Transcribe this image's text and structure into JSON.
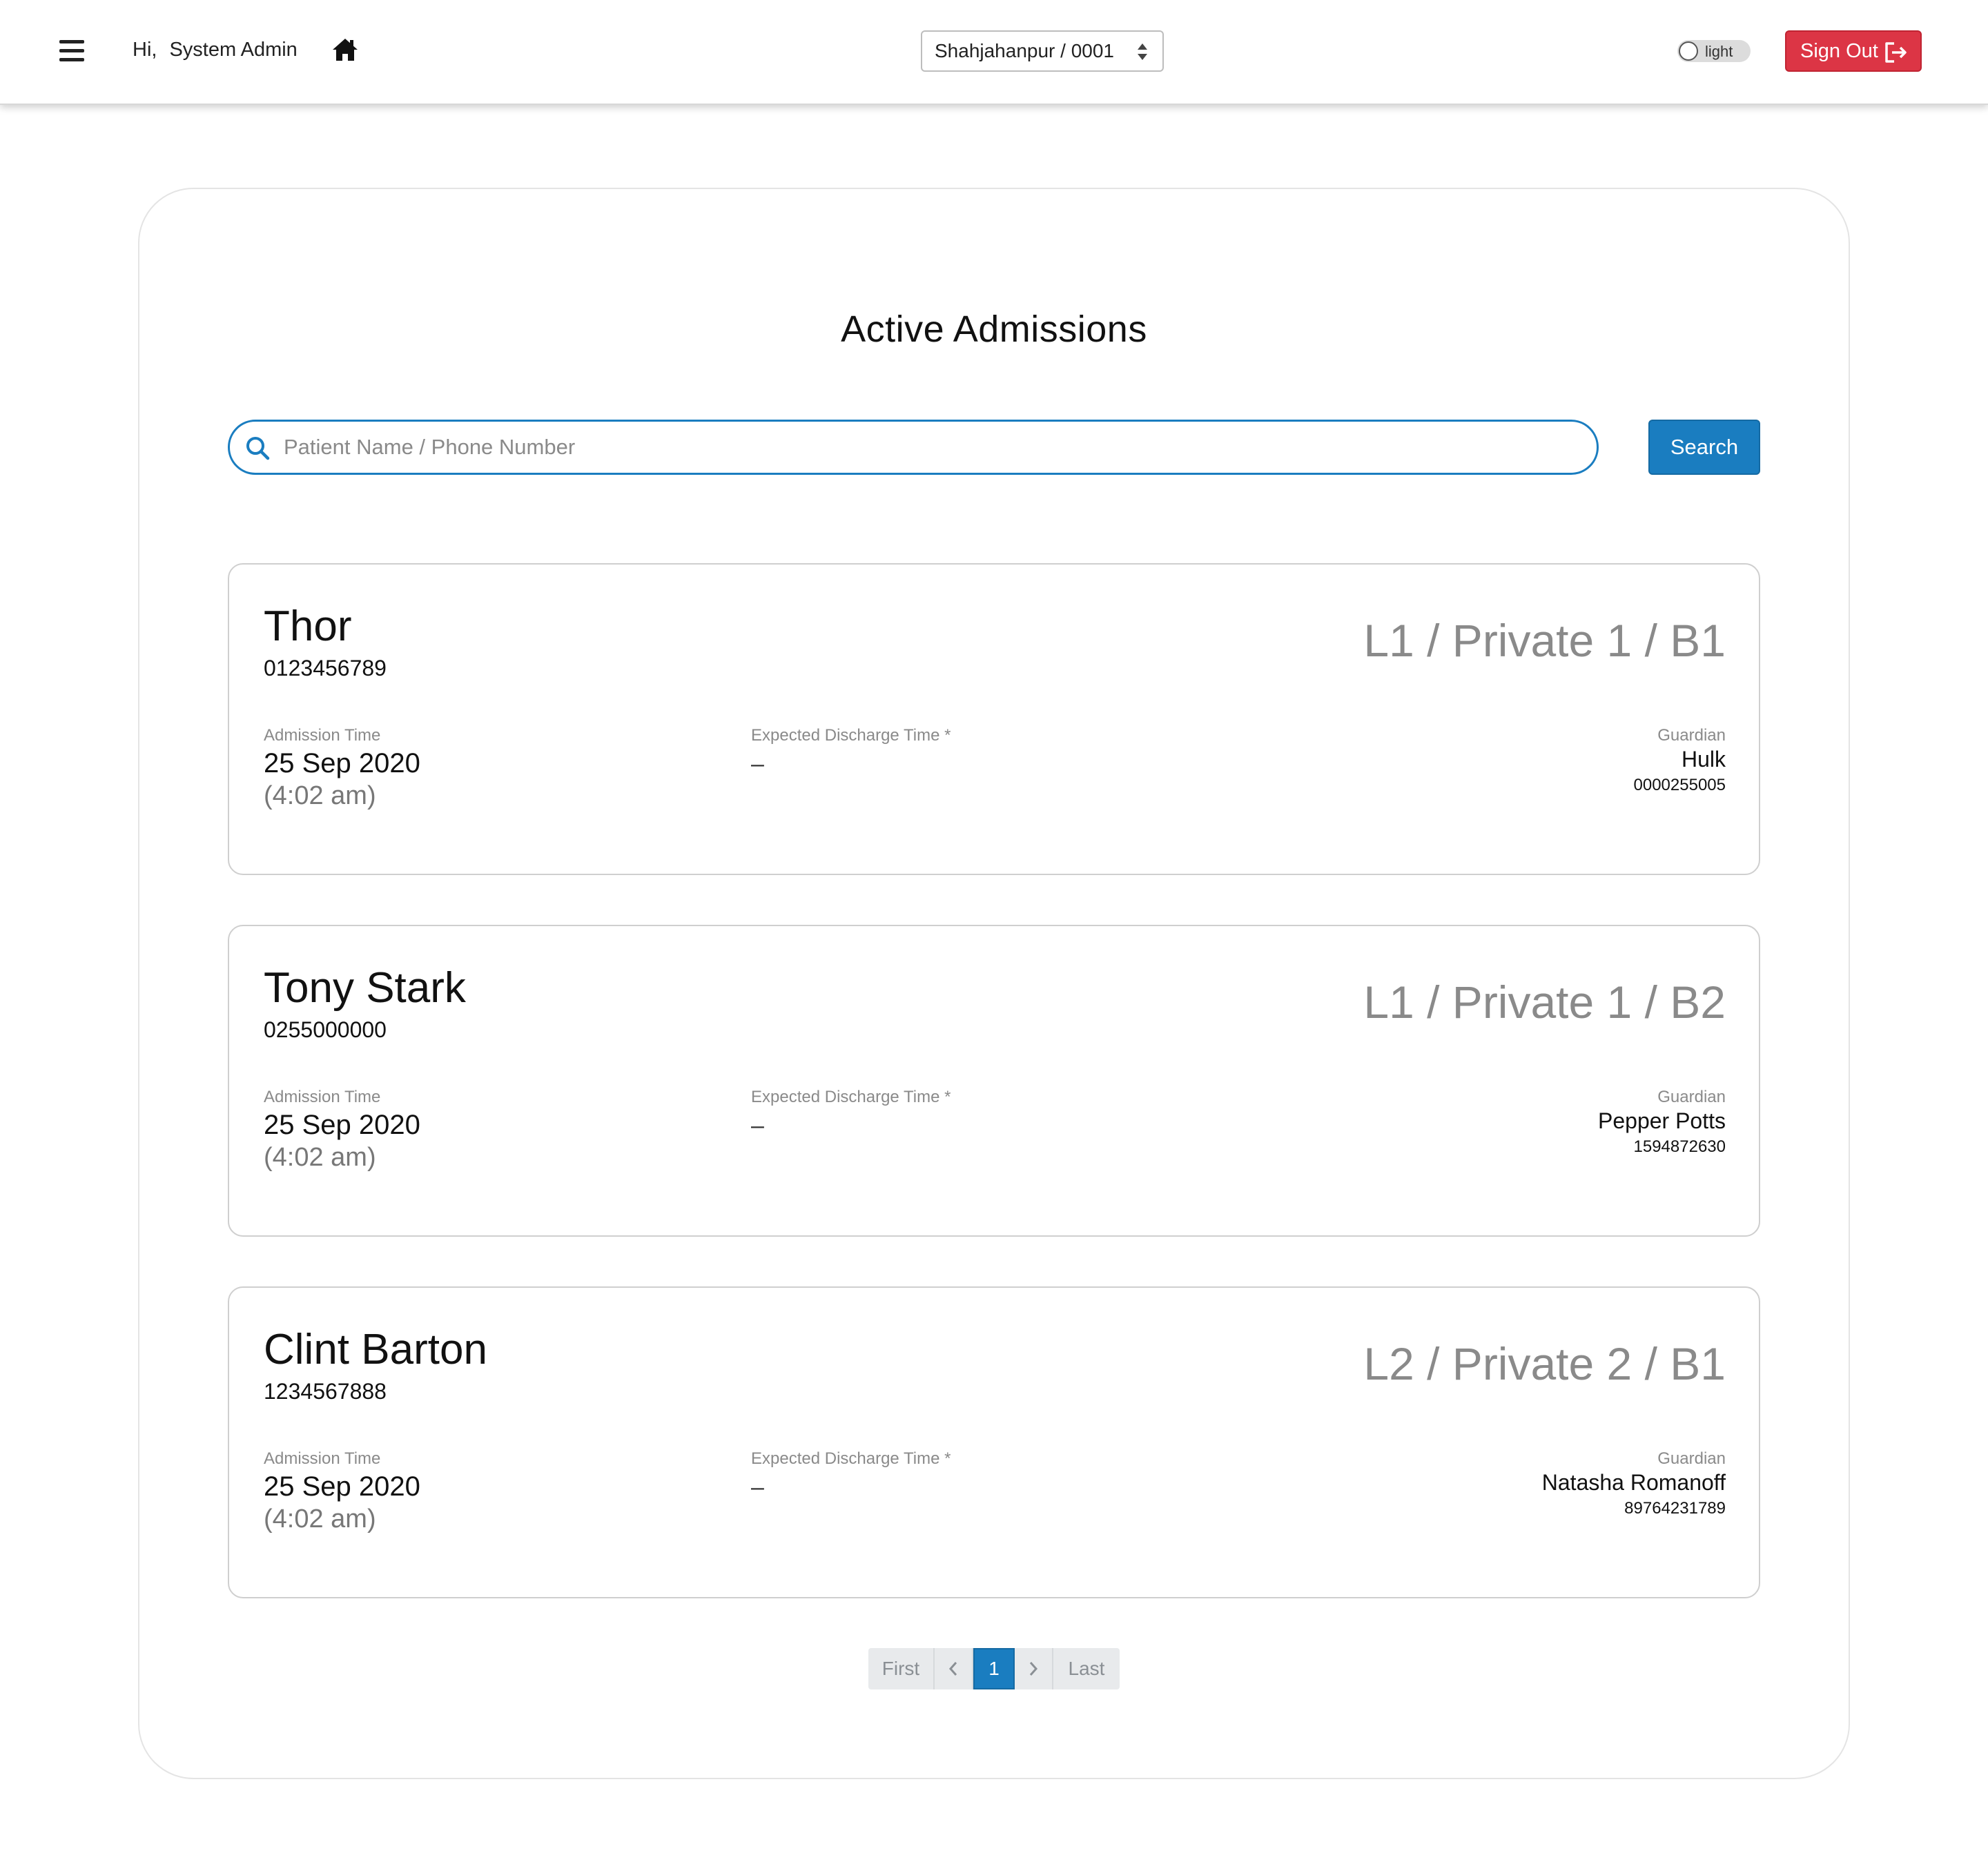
{
  "header": {
    "greeting_hi": "Hi,",
    "user_name": "System Admin",
    "branch_selected": "Shahjahanpur / 0001",
    "theme_label": "light",
    "signout_label": "Sign Out",
    "signout_color": "#dc3545"
  },
  "main": {
    "title": "Active Admissions",
    "search": {
      "placeholder": "Patient Name / Phone Number",
      "value": "",
      "button_label": "Search"
    },
    "labels": {
      "admission_time": "Admission Time",
      "expected_discharge": "Expected Discharge Time *",
      "guardian": "Guardian"
    },
    "admissions": [
      {
        "name": "Thor",
        "phone": "0123456789",
        "bed": "L1 / Private 1 / B1",
        "admission_date": "25 Sep 2020",
        "admission_time": "(4:02 am)",
        "expected_discharge": "–",
        "guardian_name": "Hulk",
        "guardian_phone": "0000255005"
      },
      {
        "name": "Tony Stark",
        "phone": "0255000000",
        "bed": "L1 / Private 1 / B2",
        "admission_date": "25 Sep 2020",
        "admission_time": "(4:02 am)",
        "expected_discharge": "–",
        "guardian_name": "Pepper Potts",
        "guardian_phone": "1594872630"
      },
      {
        "name": "Clint Barton",
        "phone": "1234567888",
        "bed": "L2 / Private 2 / B1",
        "admission_date": "25 Sep 2020",
        "admission_time": "(4:02 am)",
        "expected_discharge": "–",
        "guardian_name": "Natasha Romanoff",
        "guardian_phone": "89764231789"
      }
    ]
  },
  "pagination": {
    "first": "First",
    "current": "1",
    "last": "Last"
  },
  "colors": {
    "accent": "#1a7dc0",
    "danger": "#dc3545"
  }
}
